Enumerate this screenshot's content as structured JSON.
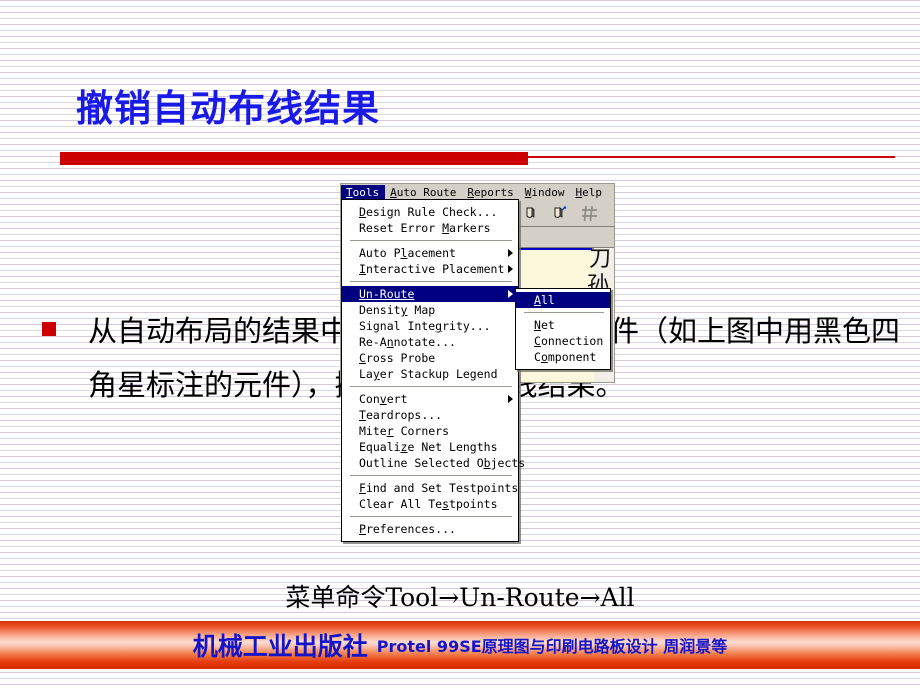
{
  "slide": {
    "title": "撤销自动布线结果",
    "body_text": "从自动布局的结果中选择要撤销布线的元件（如上图中用黑色四角星标注的元件），撤销其自动布线结果。",
    "menu_caption": "菜单命令Tool→Un-Route→All",
    "accent_red": "#cc0000",
    "title_blue": "#1a1ae8"
  },
  "app_window": {
    "menubar": [
      {
        "label": "Tools",
        "mnemonic": "T",
        "active": true
      },
      {
        "label": "Auto Route",
        "mnemonic": "A",
        "active": false
      },
      {
        "label": "Reports",
        "mnemonic": "R",
        "active": false
      },
      {
        "label": "Window",
        "mnemonic": "W",
        "active": false
      },
      {
        "label": "Help",
        "mnemonic": "H",
        "active": false
      }
    ],
    "toolbar_icons": [
      "component-place-icon",
      "net-place-icon",
      "grid-icon",
      "undo-icon"
    ],
    "canvas_glyphs": [
      "刀",
      "孙"
    ]
  },
  "tools_menu": {
    "items": [
      {
        "label": "Design Rule Check...",
        "type": "item",
        "submenu": false,
        "selected": false
      },
      {
        "label": "Reset Error Markers",
        "type": "item",
        "submenu": false,
        "selected": false
      },
      {
        "type": "separator"
      },
      {
        "label": "Auto Placement",
        "type": "item",
        "submenu": true,
        "selected": false
      },
      {
        "label": "Interactive Placement",
        "type": "item",
        "submenu": true,
        "selected": false
      },
      {
        "type": "separator"
      },
      {
        "label": "Un-Route",
        "type": "item",
        "submenu": true,
        "selected": true
      },
      {
        "label": "Density Map",
        "type": "item",
        "submenu": false,
        "selected": false
      },
      {
        "label": "Signal Integrity...",
        "type": "item",
        "submenu": false,
        "selected": false
      },
      {
        "label": "Re-Annotate...",
        "type": "item",
        "submenu": false,
        "selected": false
      },
      {
        "label": "Cross Probe",
        "type": "item",
        "submenu": false,
        "selected": false
      },
      {
        "label": "Layer Stackup Legend",
        "type": "item",
        "submenu": false,
        "selected": false
      },
      {
        "type": "separator"
      },
      {
        "label": "Convert",
        "type": "item",
        "submenu": true,
        "selected": false
      },
      {
        "label": "Teardrops...",
        "type": "item",
        "submenu": false,
        "selected": false
      },
      {
        "label": "Miter Corners",
        "type": "item",
        "submenu": false,
        "selected": false
      },
      {
        "label": "Equalize Net Lengths",
        "type": "item",
        "submenu": false,
        "selected": false
      },
      {
        "label": "Outline Selected Objects",
        "type": "item",
        "submenu": false,
        "selected": false
      },
      {
        "type": "separator"
      },
      {
        "label": "Find and Set Testpoints",
        "type": "item",
        "submenu": false,
        "selected": false
      },
      {
        "label": "Clear All Testpoints",
        "type": "item",
        "submenu": false,
        "selected": false
      },
      {
        "type": "separator"
      },
      {
        "label": "Preferences...",
        "type": "item",
        "submenu": false,
        "selected": false
      }
    ]
  },
  "unroute_submenu": {
    "items": [
      {
        "label": "All",
        "type": "item",
        "selected": true
      },
      {
        "type": "separator"
      },
      {
        "label": "Net",
        "type": "item",
        "selected": false
      },
      {
        "label": "Connection",
        "type": "item",
        "selected": false
      },
      {
        "label": "Component",
        "type": "item",
        "selected": false
      }
    ]
  },
  "footer": {
    "publisher": "机械工业出版社",
    "book_line": "Protel 99SE原理图与印刷电路板设计 周润景等",
    "text_color": "#1414c8"
  }
}
